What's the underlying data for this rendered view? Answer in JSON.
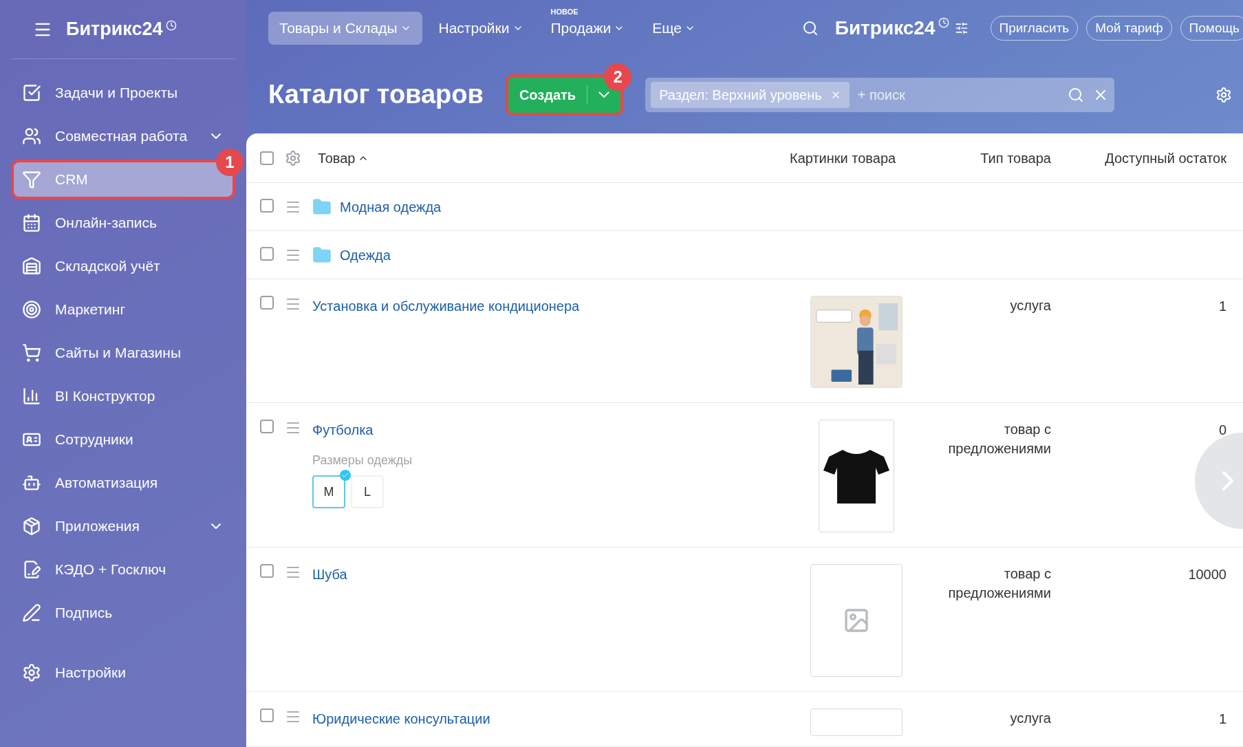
{
  "sidebar": {
    "logo": "Битрикс24",
    "items": [
      {
        "label": "Задачи и Проекты",
        "selected": false,
        "submenu": false
      },
      {
        "label": "Совместная работа",
        "selected": false,
        "submenu": true
      },
      {
        "label": "CRM",
        "selected": true,
        "submenu": false,
        "callout": "1"
      },
      {
        "label": "Онлайн-запись",
        "selected": false,
        "submenu": false
      },
      {
        "label": "Складской учёт",
        "selected": false,
        "submenu": false
      },
      {
        "label": "Маркетинг",
        "selected": false,
        "submenu": false
      },
      {
        "label": "Сайты и Магазины",
        "selected": false,
        "submenu": false
      },
      {
        "label": "BI Конструктор",
        "selected": false,
        "submenu": false
      },
      {
        "label": "Сотрудники",
        "selected": false,
        "submenu": false
      },
      {
        "label": "Автоматизация",
        "selected": false,
        "submenu": false
      },
      {
        "label": "Приложения",
        "selected": false,
        "submenu": true
      },
      {
        "label": "КЭДО + Госключ",
        "selected": false,
        "submenu": false
      },
      {
        "label": "Подпись",
        "selected": false,
        "submenu": false
      },
      {
        "label": "Настройки",
        "selected": false,
        "submenu": false
      }
    ]
  },
  "topbar": {
    "nav": [
      {
        "label": "Товары и Склады",
        "selected": true
      },
      {
        "label": "Настройки",
        "selected": false
      },
      {
        "label": "Продажи",
        "selected": false,
        "badge": "НОВОЕ"
      },
      {
        "label": "Еще",
        "selected": false
      }
    ],
    "logo": "Битрикс24",
    "buttons": [
      "Пригласить",
      "Мой тариф",
      "Помощь"
    ]
  },
  "page": {
    "title": "Каталог товаров",
    "create_button": "Создать",
    "create_callout": "2",
    "filter": {
      "tag": "Раздел: Верхний уровень",
      "placeholder": "+ поиск"
    }
  },
  "table": {
    "select_all_checked": false,
    "columns": [
      "Товар",
      "Картинки товара",
      "Тип товара",
      "Доступный остаток"
    ],
    "rows": [
      {
        "kind": "folder",
        "checked": false,
        "name": "Модная одежда"
      },
      {
        "kind": "folder",
        "checked": false,
        "name": "Одежда"
      },
      {
        "kind": "item",
        "checked": false,
        "name": "Установка и обслуживание кондиционера",
        "picture": {
          "kind": "photo"
        },
        "type": "услуга",
        "stock": "1"
      },
      {
        "kind": "item",
        "checked": false,
        "name": "Футболка",
        "picture": {
          "kind": "tshirt"
        },
        "type": "товар с предложениями",
        "stock": "0",
        "variants": {
          "label": "Размеры одежды",
          "options": [
            {
              "label": "M",
              "selected": true
            },
            {
              "label": "L",
              "selected": false
            }
          ]
        }
      },
      {
        "kind": "item",
        "checked": false,
        "name": "Шуба",
        "picture": {
          "kind": "empty"
        },
        "type": "товар с предложениями",
        "stock": "10000"
      },
      {
        "kind": "item",
        "checked": false,
        "name": "Юридические консультации",
        "picture": {
          "kind": "empty"
        },
        "type": "услуга",
        "stock": "1"
      }
    ]
  }
}
